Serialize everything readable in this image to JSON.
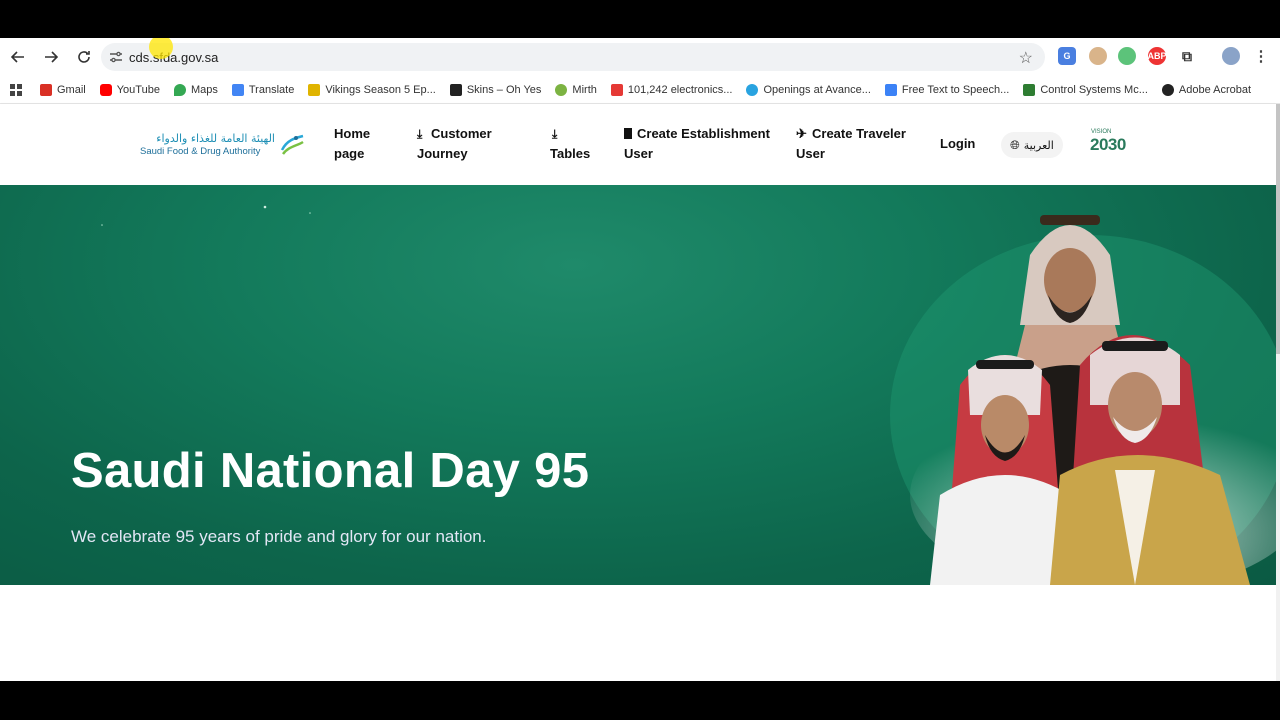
{
  "browser": {
    "url": "cds.sfda.gov.sa",
    "bookmarks": [
      {
        "label": "Gmail",
        "icon": "gmail-icon",
        "color": "#d93025"
      },
      {
        "label": "YouTube",
        "icon": "youtube-icon",
        "color": "#ff0000"
      },
      {
        "label": "Maps",
        "icon": "maps-icon",
        "color": "#34a853"
      },
      {
        "label": "Translate",
        "icon": "translate-icon",
        "color": "#4285f4"
      },
      {
        "label": "Vikings Season 5 Ep...",
        "icon": "bookmark-icon",
        "color": "#e0b400"
      },
      {
        "label": "Skins – Oh Yes",
        "icon": "bookmark-icon",
        "color": "#222222"
      },
      {
        "label": "Mirth",
        "icon": "mirth-icon",
        "color": "#7cb342"
      },
      {
        "label": "101,242 electronics...",
        "icon": "s-icon",
        "color": "#e53935"
      },
      {
        "label": "Openings at Avance...",
        "icon": "openings-icon",
        "color": "#29a3e0"
      },
      {
        "label": "Free Text to Speech...",
        "icon": "n-icon",
        "color": "#3b82f6"
      },
      {
        "label": "Control Systems Mc...",
        "icon": "control-icon",
        "color": "#2e7d32"
      },
      {
        "label": "Adobe Acrobat",
        "icon": "acrobat-icon",
        "color": "#222222"
      }
    ]
  },
  "site": {
    "logo_ar": "الهيئة العامة للغذاء والدواء",
    "logo_en": "Saudi Food & Drug Authority",
    "nav": [
      {
        "line1": "Home",
        "line2": "page",
        "icon": ""
      },
      {
        "line1": "Customer",
        "line2": "Journey",
        "icon": "download-icon"
      },
      {
        "line1": "",
        "line2": "Tables",
        "icon": "download-icon"
      },
      {
        "line1": "Create Establishment",
        "line2": "User",
        "icon": "building-icon"
      },
      {
        "line1": "Create Traveler",
        "line2": "User",
        "icon": "plane-icon"
      }
    ],
    "login": "Login",
    "language": "العربية",
    "vision_text": "2030",
    "vision_label": "VISION",
    "brand_color": "#137a5b"
  },
  "hero": {
    "title": "Saudi National Day 95",
    "subtitle": "We celebrate 95 years of pride and glory for our nation."
  }
}
